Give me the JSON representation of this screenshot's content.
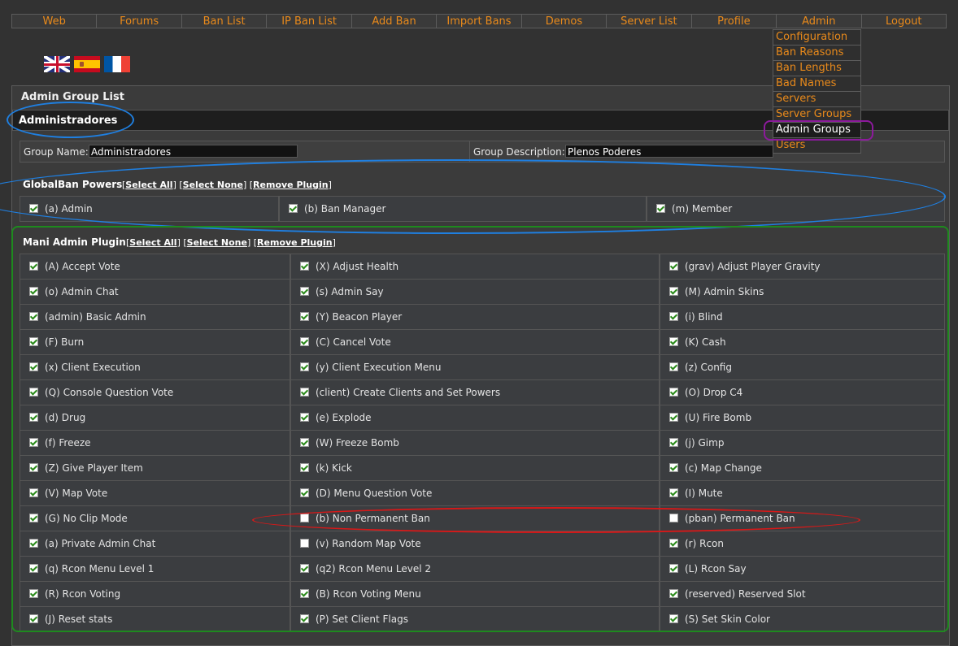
{
  "nav": [
    "Web",
    "Forums",
    "Ban List",
    "IP Ban List",
    "Add Ban",
    "Import Bans",
    "Demos",
    "Server List",
    "Profile",
    "Admin",
    "Logout"
  ],
  "admin_menu": [
    "Configuration",
    "Ban Reasons",
    "Ban Lengths",
    "Bad Names",
    "Servers",
    "Server Groups",
    "Admin Groups",
    "Users"
  ],
  "admin_menu_active": "Admin Groups",
  "flags": [
    "uk-flag-icon",
    "spain-flag-icon",
    "france-flag-icon"
  ],
  "panel": {
    "title": "Admin Group List",
    "group_header": "Administradores",
    "group_name_label": "Group Name:",
    "group_name_value": "Administradores",
    "group_desc_label": "Group Description:",
    "group_desc_value": "Plenos Poderes"
  },
  "links": {
    "select_all": "Select All",
    "select_none": "Select None",
    "remove_plugin": "Remove Plugin"
  },
  "globalban": {
    "title": "GlobalBan Powers",
    "items": [
      {
        "label": "(a) Admin",
        "checked": true
      },
      {
        "label": "(b) Ban Manager",
        "checked": true
      },
      {
        "label": "(m) Member",
        "checked": true
      }
    ]
  },
  "mani": {
    "title": "Mani Admin Plugin",
    "rows": [
      [
        {
          "label": "(A) Accept Vote",
          "checked": true
        },
        {
          "label": "(X) Adjust Health",
          "checked": true
        },
        {
          "label": "(grav) Adjust Player Gravity",
          "checked": true
        }
      ],
      [
        {
          "label": "(o) Admin Chat",
          "checked": true
        },
        {
          "label": "(s) Admin Say",
          "checked": true
        },
        {
          "label": "(M) Admin Skins",
          "checked": true
        }
      ],
      [
        {
          "label": "(admin) Basic Admin",
          "checked": true
        },
        {
          "label": "(Y) Beacon Player",
          "checked": true
        },
        {
          "label": "(i) Blind",
          "checked": true
        }
      ],
      [
        {
          "label": "(F) Burn",
          "checked": true
        },
        {
          "label": "(C) Cancel Vote",
          "checked": true
        },
        {
          "label": "(K) Cash",
          "checked": true
        }
      ],
      [
        {
          "label": "(x) Client Execution",
          "checked": true
        },
        {
          "label": "(y) Client Execution Menu",
          "checked": true
        },
        {
          "label": "(z) Config",
          "checked": true
        }
      ],
      [
        {
          "label": "(Q) Console Question Vote",
          "checked": true
        },
        {
          "label": "(client) Create Clients and Set Powers",
          "checked": true
        },
        {
          "label": "(O) Drop C4",
          "checked": true
        }
      ],
      [
        {
          "label": "(d) Drug",
          "checked": true
        },
        {
          "label": "(e) Explode",
          "checked": true
        },
        {
          "label": "(U) Fire Bomb",
          "checked": true
        }
      ],
      [
        {
          "label": "(f) Freeze",
          "checked": true
        },
        {
          "label": "(W) Freeze Bomb",
          "checked": true
        },
        {
          "label": "(j) Gimp",
          "checked": true
        }
      ],
      [
        {
          "label": "(Z) Give Player Item",
          "checked": true
        },
        {
          "label": "(k) Kick",
          "checked": true
        },
        {
          "label": "(c) Map Change",
          "checked": true
        }
      ],
      [
        {
          "label": "(V) Map Vote",
          "checked": true
        },
        {
          "label": "(D) Menu Question Vote",
          "checked": true
        },
        {
          "label": "(I) Mute",
          "checked": true
        }
      ],
      [
        {
          "label": "(G) No Clip Mode",
          "checked": true
        },
        {
          "label": "(b) Non Permanent Ban",
          "checked": false
        },
        {
          "label": "(pban) Permanent Ban",
          "checked": false
        }
      ],
      [
        {
          "label": "(a) Private Admin Chat",
          "checked": true
        },
        {
          "label": "(v) Random Map Vote",
          "checked": false
        },
        {
          "label": "(r) Rcon",
          "checked": true
        }
      ],
      [
        {
          "label": "(q) Rcon Menu Level 1",
          "checked": true
        },
        {
          "label": "(q2) Rcon Menu Level 2",
          "checked": true
        },
        {
          "label": "(L) Rcon Say",
          "checked": true
        }
      ],
      [
        {
          "label": "(R) Rcon Voting",
          "checked": true
        },
        {
          "label": "(B) Rcon Voting Menu",
          "checked": true
        },
        {
          "label": "(reserved) Reserved Slot",
          "checked": true
        }
      ],
      [
        {
          "label": "(J) Reset stats",
          "checked": true
        },
        {
          "label": "(P) Set Client Flags",
          "checked": true
        },
        {
          "label": "(S) Set Skin Color",
          "checked": true
        }
      ]
    ]
  },
  "annotation_colors": {
    "blue": "#1f7fe0",
    "green": "#1e8a1e",
    "red": "#d81818",
    "purple": "#8c1a9c"
  }
}
